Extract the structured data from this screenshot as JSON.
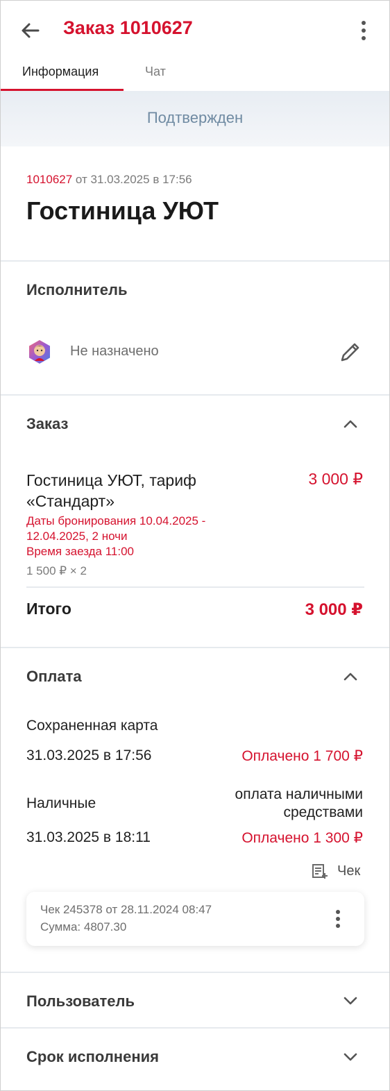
{
  "header": {
    "title": "Заказ 1010627",
    "icons": {
      "back": "arrow-left-icon",
      "more": "more-vertical-icon"
    }
  },
  "tabs": [
    {
      "label": "Информация",
      "active": true
    },
    {
      "label": "Чат",
      "active": false
    }
  ],
  "status": {
    "label": "Подтвержден"
  },
  "order_header": {
    "number": "1010627",
    "date_text": "от 31.03.2025 в 17:56",
    "hotel": "Гостиница УЮТ"
  },
  "executor": {
    "title": "Исполнитель",
    "value": "Не назначено",
    "icons": {
      "avatar": "avatar-icon",
      "edit": "pencil-icon"
    }
  },
  "order": {
    "title": "Заказ",
    "expanded": true,
    "item": {
      "name": "Гостиница УЮТ, тариф «Стандарт»",
      "price": "3 000 ₽",
      "booking_dates_line1": "Даты бронирования 10.04.2025 -",
      "booking_dates_line2": "12.04.2025, 2 ночи",
      "checkin": "Время заезда 11:00",
      "calc": "1 500 ₽ × 2"
    },
    "total_label": "Итого",
    "total_value": "3 000 ₽"
  },
  "payment": {
    "title": "Оплата",
    "expanded": true,
    "entries": [
      {
        "method": "Сохраненная карта",
        "note": "",
        "datetime": "31.03.2025 в 17:56",
        "status": "Оплачено 1 700 ₽"
      },
      {
        "method": "Наличные",
        "note_line1": "оплата наличными",
        "note_line2": "средствами",
        "datetime": "31.03.2025 в 18:11",
        "status": "Оплачено 1 300 ₽"
      }
    ],
    "receipt_link": "Чек",
    "receipt_card": {
      "line1": "Чек 245378 от 28.11.2024 08:47",
      "line2": "Сумма: 4807.30"
    }
  },
  "sections_collapsed": [
    {
      "title": "Пользователь",
      "expanded": false
    },
    {
      "title": "Срок исполнения",
      "expanded": false
    }
  ],
  "colors": {
    "accent": "#d5122e",
    "status_text": "#6f8aa2",
    "divider": "#e6eaee"
  }
}
